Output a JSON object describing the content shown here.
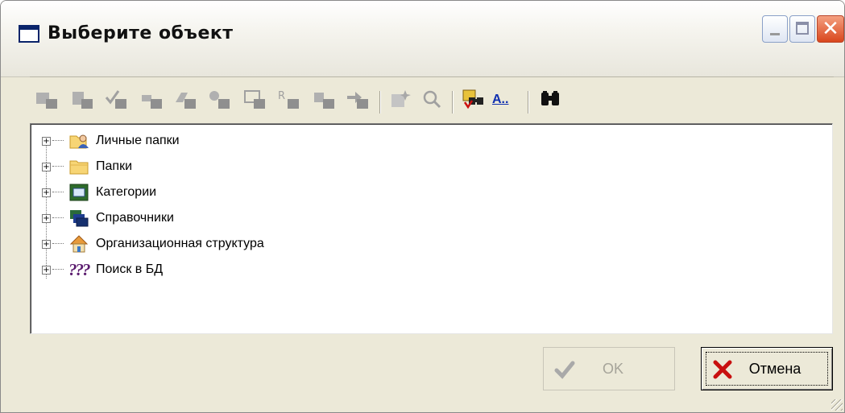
{
  "window": {
    "title": "Выберите объект",
    "controls": [
      "minimize-icon",
      "maximize-icon",
      "close-icon"
    ],
    "close_glyph": "✕"
  },
  "toolbar": {
    "buttons": [
      {
        "name": "search-folder-icon",
        "enabled": false
      },
      {
        "name": "search-document-icon",
        "enabled": false
      },
      {
        "name": "search-checked-icon",
        "enabled": false
      },
      {
        "name": "search-link-icon",
        "enabled": false
      },
      {
        "name": "search-tag-icon",
        "enabled": false
      },
      {
        "name": "search-attributes-icon",
        "enabled": false
      },
      {
        "name": "search-card-icon",
        "enabled": false
      },
      {
        "name": "search-requisites-icon",
        "enabled": false
      },
      {
        "name": "search-type-icon",
        "enabled": false
      },
      {
        "name": "search-forward-icon",
        "enabled": false
      },
      {
        "name": "new-object-icon",
        "enabled": false
      },
      {
        "name": "zoom-search-icon",
        "enabled": false
      },
      {
        "name": "extended-search-icon",
        "enabled": true
      },
      {
        "name": "text-search-icon",
        "enabled": true
      },
      {
        "name": "binoculars-icon",
        "enabled": true
      }
    ],
    "text_search_label": "A.."
  },
  "tree": {
    "items": [
      {
        "label": "Личные папки",
        "icon": "personal-folder-icon"
      },
      {
        "label": "Папки",
        "icon": "folder-icon"
      },
      {
        "label": "Категории",
        "icon": "categories-icon"
      },
      {
        "label": "Справочники",
        "icon": "directories-icon"
      },
      {
        "label": "Организационная структура",
        "icon": "org-structure-icon"
      },
      {
        "label": "Поиск в БД",
        "icon": "db-search-icon",
        "glyph": "???"
      }
    ],
    "expander_glyph": "+"
  },
  "buttons": {
    "ok_label": "OK",
    "ok_enabled": false,
    "cancel_label": "Отмена"
  },
  "colors": {
    "dialog_bg": "#ece9d8",
    "title_text": "#111111",
    "close_button": "#d9461d",
    "disabled_text": "#a6a49a"
  }
}
